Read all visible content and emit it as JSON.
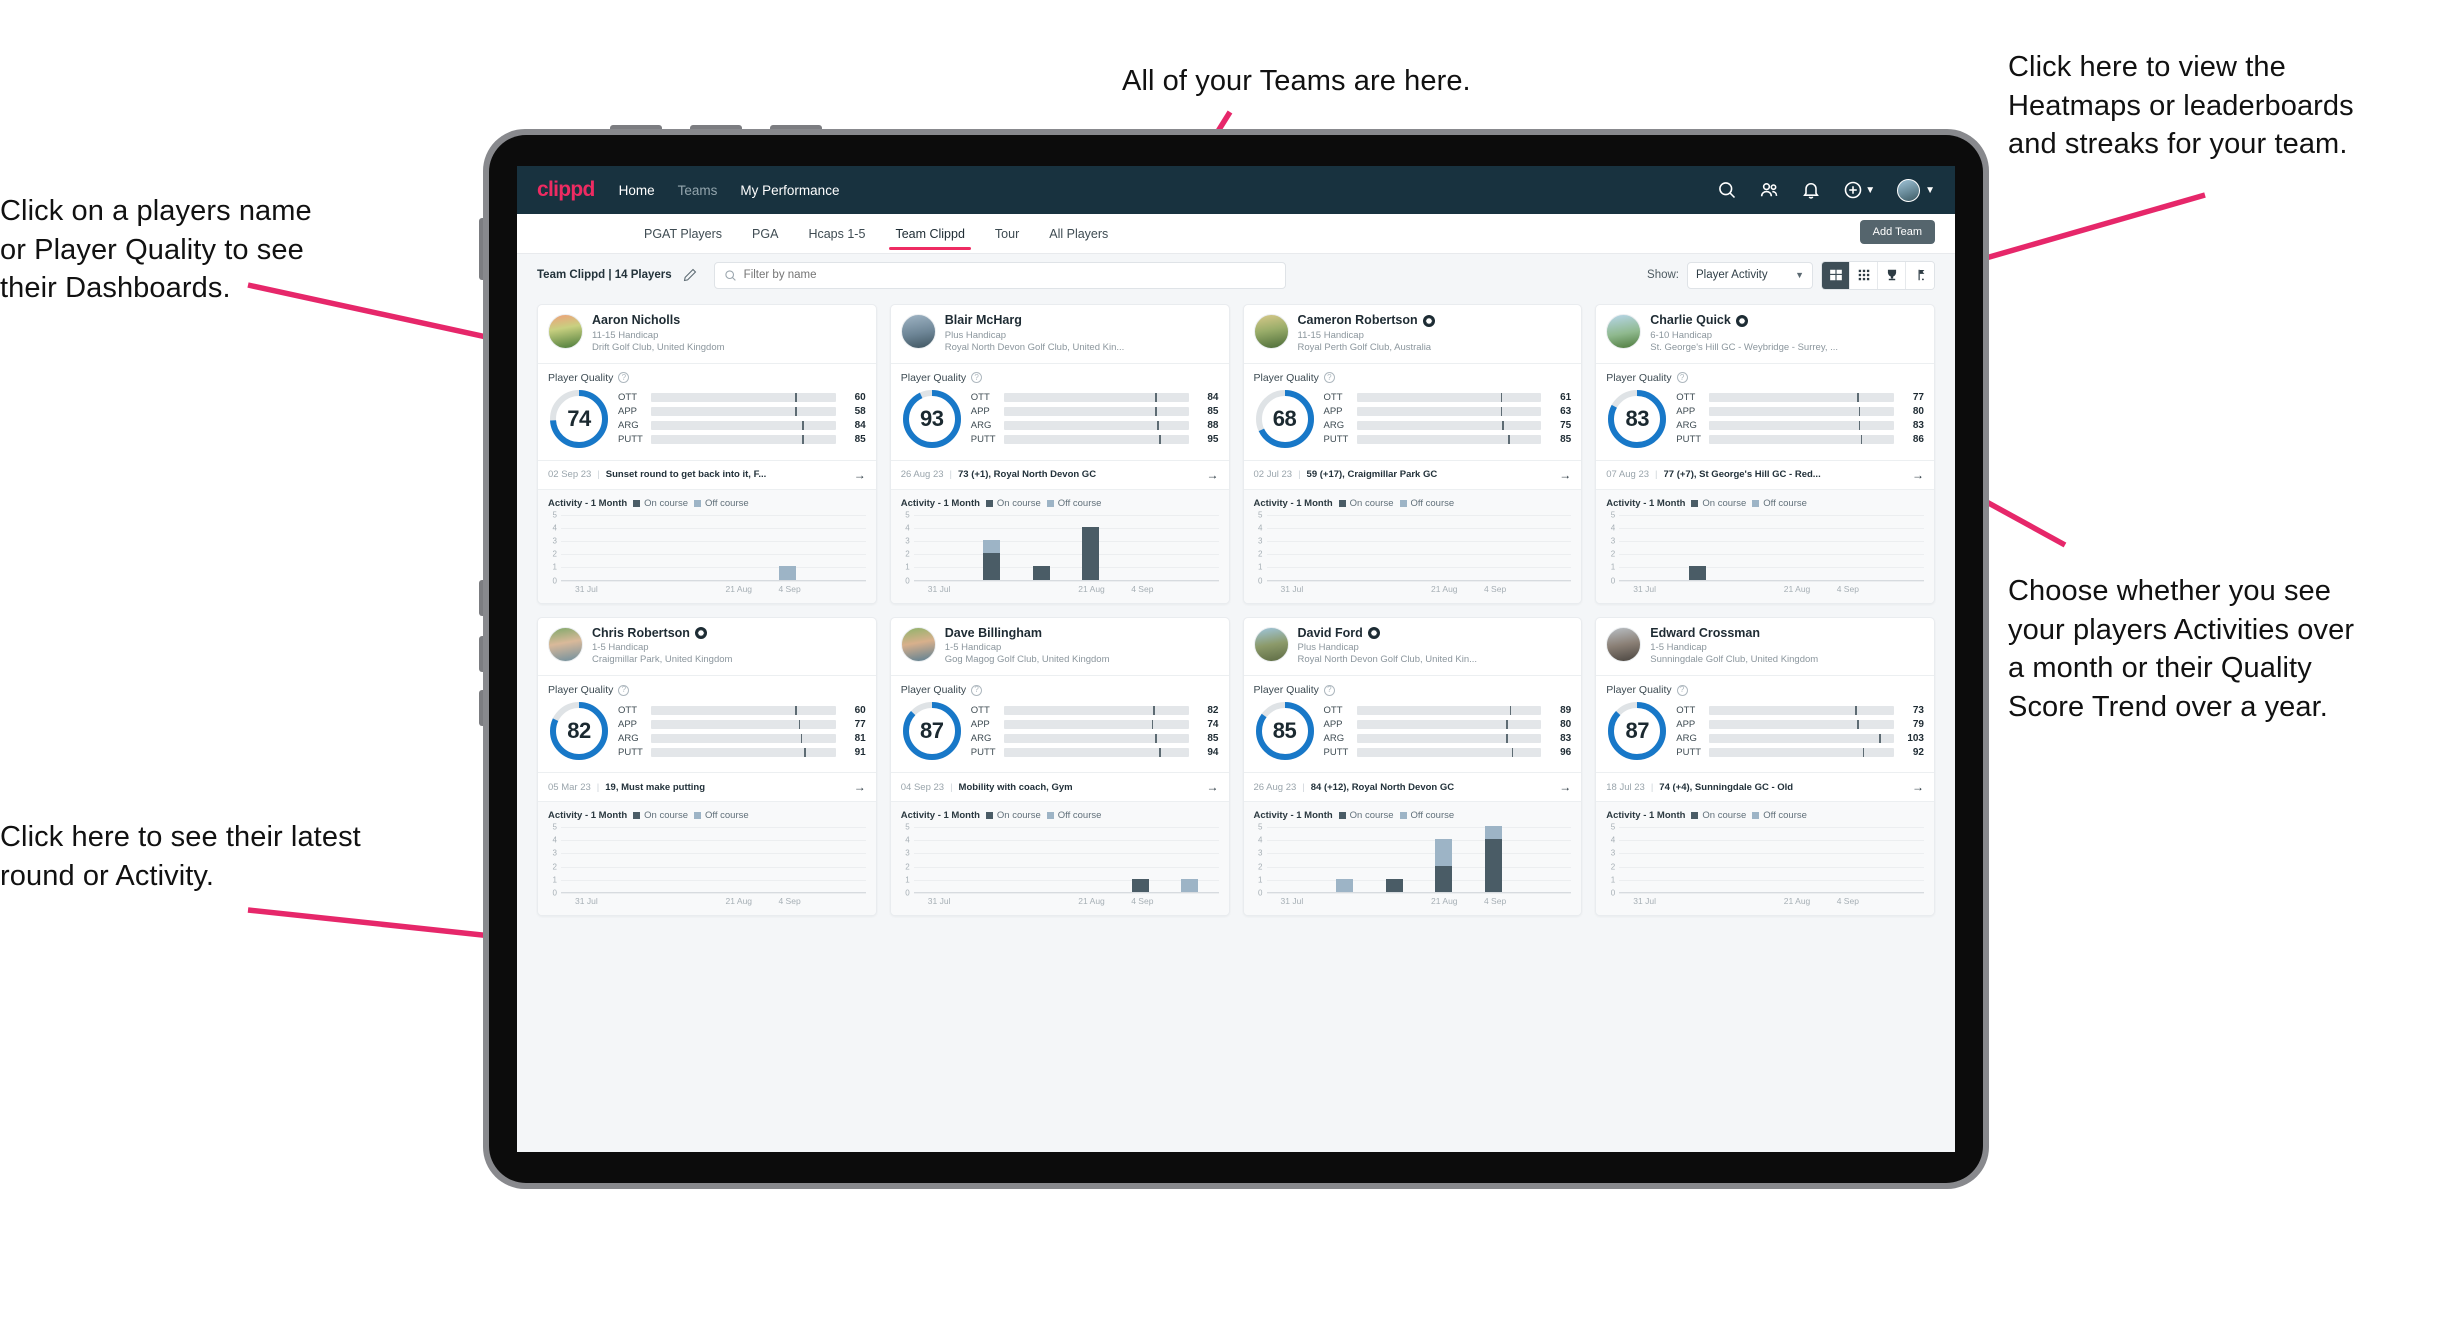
{
  "annotations": {
    "teams": "All of your Teams are here.",
    "names": "Click on a players name\nor Player Quality to see\ntheir Dashboards.",
    "heatmaps": "Click here to view the\nHeatmaps or leaderboards\nand streaks for your team.",
    "choose": "Choose whether you see\nyour players Activities over\na month or their Quality\nScore Trend over a year.",
    "latest": "Click here to see their latest\nround or Activity.",
    "arrow_color": "#e6276a"
  },
  "header": {
    "logo": "clippd",
    "nav": [
      {
        "label": "Home",
        "active": true
      },
      {
        "label": "Teams",
        "active": false
      },
      {
        "label": "My Performance",
        "active": true
      }
    ],
    "icons": [
      "search-icon",
      "people-icon",
      "bell-icon",
      "plus-circle-icon",
      "avatar"
    ],
    "brand_color": "#ee2b62",
    "bar_color": "#18323f"
  },
  "tabs": [
    {
      "label": "PGAT Players",
      "active": false
    },
    {
      "label": "PGA",
      "active": false
    },
    {
      "label": "Hcaps 1-5",
      "active": false
    },
    {
      "label": "Team Clippd",
      "active": true
    },
    {
      "label": "Tour",
      "active": false
    },
    {
      "label": "All Players",
      "active": false
    }
  ],
  "add_team_label": "Add Team",
  "filterbar": {
    "team_label": "Team Clippd | 14 Players",
    "edit_icon": "pencil-icon",
    "search_placeholder": "Filter by name",
    "search_value": "",
    "show_label": "Show:",
    "show_value": "Player Activity",
    "show_options": [
      "Player Activity",
      "Quality Score Trend"
    ],
    "view_buttons": [
      {
        "name": "card-view",
        "icon": "grid-card-icon",
        "active": true
      },
      {
        "name": "dense-grid-view",
        "icon": "grid-dots-icon",
        "active": false
      },
      {
        "name": "leaderboard-view",
        "icon": "trophy-icon",
        "active": false
      },
      {
        "name": "heatmap-view",
        "icon": "flag-icon",
        "active": false
      }
    ]
  },
  "card_labels": {
    "player_quality": "Player Quality",
    "activity": "Activity - 1 Month",
    "legend_on": "On course",
    "legend_off": "Off course",
    "metric_names": [
      "OTT",
      "APP",
      "ARG",
      "PUTT"
    ],
    "metric_colors": [
      "#f5a800",
      "#3ad6ac",
      "#f50a5a",
      "#b400c8"
    ],
    "ring_color": "#1878c8",
    "x_labels": [
      "31 Jul",
      "21 Aug",
      "4 Sep"
    ],
    "y_ticks": [
      "5",
      "4",
      "3",
      "2",
      "1",
      "0"
    ]
  },
  "players": [
    {
      "name": "Aaron Nicholls",
      "verified": false,
      "handicap": "11-15 Handicap",
      "club": "Drift Golf Club, United Kingdom",
      "avatar_gradient": "linear-gradient(170deg,#f0a07a 0%,#c8d080 40%,#4a7a3a 100%)",
      "quality": 74,
      "metrics": [
        {
          "name": "OTT",
          "value": 60,
          "fill_pct": 56,
          "tick_pct": 78
        },
        {
          "name": "APP",
          "value": 58,
          "fill_pct": 54,
          "tick_pct": 78
        },
        {
          "name": "ARG",
          "value": 84,
          "fill_pct": 73,
          "tick_pct": 82
        },
        {
          "name": "PUTT",
          "value": 85,
          "fill_pct": 74,
          "tick_pct": 82
        }
      ],
      "latest_date": "02 Sep 23",
      "latest_text": "Sunset round to get back into it, F...",
      "activity": [
        {
          "on": 0,
          "off": 0
        },
        {
          "on": 0,
          "off": 0
        },
        {
          "on": 0,
          "off": 0
        },
        {
          "on": 0,
          "off": 0
        },
        {
          "on": 0,
          "off": 1
        },
        {
          "on": 0,
          "off": 0
        }
      ]
    },
    {
      "name": "Blair McHarg",
      "verified": false,
      "handicap": "Plus Handicap",
      "club": "Royal North Devon Golf Club, United Kin...",
      "avatar_gradient": "linear-gradient(170deg,#9fb4c4 0%,#6d8596 55%,#3f5560 100%)",
      "quality": 93,
      "metrics": [
        {
          "name": "OTT",
          "value": 84,
          "fill_pct": 73,
          "tick_pct": 82
        },
        {
          "name": "APP",
          "value": 85,
          "fill_pct": 73,
          "tick_pct": 82
        },
        {
          "name": "ARG",
          "value": 88,
          "fill_pct": 76,
          "tick_pct": 83
        },
        {
          "name": "PUTT",
          "value": 95,
          "fill_pct": 80,
          "tick_pct": 84
        }
      ],
      "latest_date": "26 Aug 23",
      "latest_text": "73 (+1), Royal North Devon GC",
      "activity": [
        {
          "on": 0,
          "off": 0
        },
        {
          "on": 2,
          "off": 1
        },
        {
          "on": 1,
          "off": 0
        },
        {
          "on": 4,
          "off": 0
        },
        {
          "on": 0,
          "off": 0
        },
        {
          "on": 0,
          "off": 0
        }
      ]
    },
    {
      "name": "Cameron Robertson",
      "verified": true,
      "handicap": "11-15 Handicap",
      "club": "Royal Perth Golf Club, Australia",
      "avatar_gradient": "linear-gradient(170deg,#d8c98a 0%,#9aad6a 45%,#4b6b38 100%)",
      "quality": 68,
      "metrics": [
        {
          "name": "OTT",
          "value": 61,
          "fill_pct": 55,
          "tick_pct": 78
        },
        {
          "name": "APP",
          "value": 63,
          "fill_pct": 56,
          "tick_pct": 78
        },
        {
          "name": "ARG",
          "value": 75,
          "fill_pct": 65,
          "tick_pct": 79
        },
        {
          "name": "PUTT",
          "value": 85,
          "fill_pct": 74,
          "tick_pct": 82
        }
      ],
      "latest_date": "02 Jul 23",
      "latest_text": "59 (+17), Craigmillar Park GC",
      "activity": [
        {
          "on": 0,
          "off": 0
        },
        {
          "on": 0,
          "off": 0
        },
        {
          "on": 0,
          "off": 0
        },
        {
          "on": 0,
          "off": 0
        },
        {
          "on": 0,
          "off": 0
        },
        {
          "on": 0,
          "off": 0
        }
      ]
    },
    {
      "name": "Charlie Quick",
      "verified": true,
      "handicap": "6-10 Handicap",
      "club": "St. George's Hill GC - Weybridge - Surrey, ...",
      "avatar_gradient": "linear-gradient(170deg,#b7d6ea 0%,#8fb98e 55%,#4d7a3c 100%)",
      "quality": 83,
      "metrics": [
        {
          "name": "OTT",
          "value": 77,
          "fill_pct": 67,
          "tick_pct": 80
        },
        {
          "name": "APP",
          "value": 80,
          "fill_pct": 70,
          "tick_pct": 81
        },
        {
          "name": "ARG",
          "value": 83,
          "fill_pct": 70,
          "tick_pct": 81
        },
        {
          "name": "PUTT",
          "value": 86,
          "fill_pct": 75,
          "tick_pct": 82
        }
      ],
      "latest_date": "07 Aug 23",
      "latest_text": "77 (+7), St George's Hill GC - Red...",
      "activity": [
        {
          "on": 0,
          "off": 0
        },
        {
          "on": 1,
          "off": 0
        },
        {
          "on": 0,
          "off": 0
        },
        {
          "on": 0,
          "off": 0
        },
        {
          "on": 0,
          "off": 0
        },
        {
          "on": 0,
          "off": 0
        }
      ]
    },
    {
      "name": "Chris Robertson",
      "verified": true,
      "handicap": "1-5 Handicap",
      "club": "Craigmillar Park, United Kingdom",
      "avatar_gradient": "linear-gradient(170deg,#7fa86a 0%,#d9b99a 45%,#6e8f9e 100%)",
      "quality": 82,
      "metrics": [
        {
          "name": "OTT",
          "value": 60,
          "fill_pct": 55,
          "tick_pct": 78
        },
        {
          "name": "APP",
          "value": 77,
          "fill_pct": 68,
          "tick_pct": 80
        },
        {
          "name": "ARG",
          "value": 81,
          "fill_pct": 70,
          "tick_pct": 81
        },
        {
          "name": "PUTT",
          "value": 91,
          "fill_pct": 78,
          "tick_pct": 83
        }
      ],
      "latest_date": "05 Mar 23",
      "latest_text": "19, Must make putting",
      "activity": [
        {
          "on": 0,
          "off": 0
        },
        {
          "on": 0,
          "off": 0
        },
        {
          "on": 0,
          "off": 0
        },
        {
          "on": 0,
          "off": 0
        },
        {
          "on": 0,
          "off": 0
        },
        {
          "on": 0,
          "off": 0
        }
      ]
    },
    {
      "name": "Dave Billingham",
      "verified": false,
      "handicap": "1-5 Handicap",
      "club": "Gog Magog Golf Club, United Kingdom",
      "avatar_gradient": "linear-gradient(170deg,#8fb36a 0%,#d8b08c 45%,#5a7f93 100%)",
      "quality": 87,
      "metrics": [
        {
          "name": "OTT",
          "value": 82,
          "fill_pct": 72,
          "tick_pct": 81
        },
        {
          "name": "APP",
          "value": 74,
          "fill_pct": 66,
          "tick_pct": 80
        },
        {
          "name": "ARG",
          "value": 85,
          "fill_pct": 74,
          "tick_pct": 82
        },
        {
          "name": "PUTT",
          "value": 94,
          "fill_pct": 80,
          "tick_pct": 84
        }
      ],
      "latest_date": "04 Sep 23",
      "latest_text": "Mobility with coach, Gym",
      "activity": [
        {
          "on": 0,
          "off": 0
        },
        {
          "on": 0,
          "off": 0
        },
        {
          "on": 0,
          "off": 0
        },
        {
          "on": 0,
          "off": 0
        },
        {
          "on": 1,
          "off": 0
        },
        {
          "on": 0,
          "off": 1
        }
      ]
    },
    {
      "name": "David Ford",
      "verified": true,
      "handicap": "Plus Handicap",
      "club": "Royal North Devon Golf Club, United Kin...",
      "avatar_gradient": "linear-gradient(170deg,#9fc6dd 0%,#8c9a6a 50%,#5d6b44 100%)",
      "quality": 85,
      "metrics": [
        {
          "name": "OTT",
          "value": 89,
          "fill_pct": 77,
          "tick_pct": 83
        },
        {
          "name": "APP",
          "value": 80,
          "fill_pct": 70,
          "tick_pct": 81
        },
        {
          "name": "ARG",
          "value": 83,
          "fill_pct": 71,
          "tick_pct": 81
        },
        {
          "name": "PUTT",
          "value": 96,
          "fill_pct": 82,
          "tick_pct": 84
        }
      ],
      "latest_date": "26 Aug 23",
      "latest_text": "84 (+12), Royal North Devon GC",
      "activity": [
        {
          "on": 0,
          "off": 0
        },
        {
          "on": 0,
          "off": 1
        },
        {
          "on": 1,
          "off": 0
        },
        {
          "on": 2,
          "off": 2
        },
        {
          "on": 4,
          "off": 1
        },
        {
          "on": 0,
          "off": 0
        }
      ]
    },
    {
      "name": "Edward Crossman",
      "verified": false,
      "handicap": "1-5 Handicap",
      "club": "Sunningdale Golf Club, United Kingdom",
      "avatar_gradient": "linear-gradient(170deg,#b9bfc4 0%,#8a7f75 50%,#4a4540 100%)",
      "quality": 87,
      "metrics": [
        {
          "name": "OTT",
          "value": 73,
          "fill_pct": 64,
          "tick_pct": 79
        },
        {
          "name": "APP",
          "value": 79,
          "fill_pct": 69,
          "tick_pct": 80
        },
        {
          "name": "ARG",
          "value": 103,
          "fill_pct": 88,
          "tick_pct": 92
        },
        {
          "name": "PUTT",
          "value": 92,
          "fill_pct": 79,
          "tick_pct": 83
        }
      ],
      "latest_date": "18 Jul 23",
      "latest_text": "74 (+4), Sunningdale GC - Old",
      "activity": [
        {
          "on": 0,
          "off": 0
        },
        {
          "on": 0,
          "off": 0
        },
        {
          "on": 0,
          "off": 0
        },
        {
          "on": 0,
          "off": 0
        },
        {
          "on": 0,
          "off": 0
        },
        {
          "on": 0,
          "off": 0
        }
      ]
    }
  ]
}
